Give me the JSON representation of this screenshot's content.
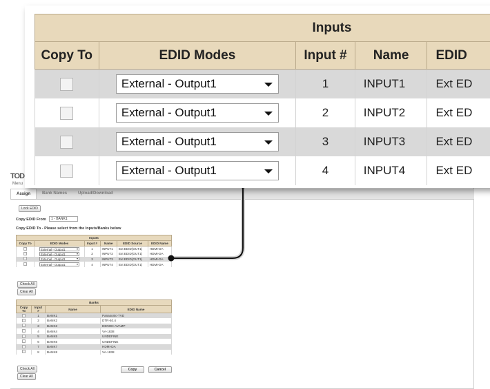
{
  "background": {
    "logo_text": "TOD",
    "menu_label": "Menu",
    "tabs": [
      {
        "label": "Assign",
        "active": true
      },
      {
        "label": "Bank Names",
        "active": false
      },
      {
        "label": "Upload/Download",
        "active": false
      }
    ],
    "lock_edid_button": "Lock EDID",
    "copy_from_label": "Copy EDID From",
    "copy_from_value": "1 - BANK1",
    "copy_to_instruction": "Copy EDID To - Please select from the Inputs/Banks below",
    "inputs_table": {
      "title": "Inputs",
      "headers": [
        "Copy To",
        "EDID Modes",
        "Input #",
        "Name",
        "EDID Source",
        "EDID Name"
      ],
      "rows": [
        {
          "mode": "External - Output1",
          "input": "1",
          "name": "INPUT1",
          "source": "Ext EDID(OUT1)",
          "edid_name": "HDMI-DA"
        },
        {
          "mode": "External - Output1",
          "input": "2",
          "name": "INPUT2",
          "source": "Ext EDID(OUT1)",
          "edid_name": "HDMI-DA"
        },
        {
          "mode": "External - Output1",
          "input": "3",
          "name": "INPUT3",
          "source": "Ext EDID(OUT1)",
          "edid_name": "HDMI-DA"
        },
        {
          "mode": "External - Output1",
          "input": "4",
          "name": "INPUT4",
          "source": "Ext EDID(OUT1)",
          "edid_name": "HDMI-DA"
        }
      ]
    },
    "check_all_button": "Check All",
    "clear_all_button": "Clear All",
    "banks_table": {
      "title": "Banks",
      "headers": [
        "Copy To",
        "Input #",
        "Name",
        "EDID Name"
      ],
      "rows": [
        {
          "input": "1",
          "name": "BANK1",
          "edid_name": "Panasonic-TVD"
        },
        {
          "input": "2",
          "name": "BANK2",
          "edid_name": "DTR-40.4"
        },
        {
          "input": "3",
          "name": "BANK3",
          "edid_name": "DENON-AVAMP"
        },
        {
          "input": "4",
          "name": "BANK4",
          "edid_name": "VA-1838"
        },
        {
          "input": "5",
          "name": "BANK5",
          "edid_name": "UNDEFINE"
        },
        {
          "input": "6",
          "name": "BANK6",
          "edid_name": "UNDEFINE"
        },
        {
          "input": "7",
          "name": "BANK7",
          "edid_name": "HDMI-DA"
        },
        {
          "input": "8",
          "name": "BANK8",
          "edid_name": "VA-1838"
        }
      ]
    },
    "check_all_button_2": "Check All",
    "clear_all_button_2": "Clear All",
    "copy_button": "Copy",
    "cancel_button": "Cancel"
  },
  "zoom": {
    "title": "Inputs",
    "headers": [
      "Copy To",
      "EDID Modes",
      "Input #",
      "Name",
      "EDID"
    ],
    "rows": [
      {
        "mode": "External - Output1",
        "input": "1",
        "name": "INPUT1",
        "source": "Ext ED"
      },
      {
        "mode": "External - Output1",
        "input": "2",
        "name": "INPUT2",
        "source": "Ext ED"
      },
      {
        "mode": "External - Output1",
        "input": "3",
        "name": "INPUT3",
        "source": "Ext ED"
      },
      {
        "mode": "External - Output1",
        "input": "4",
        "name": "INPUT4",
        "source": "Ext ED"
      }
    ]
  },
  "colors": {
    "header_bg": "#e8d9bb",
    "row_alt_bg": "#d9d9d9",
    "callout_line": "#111111"
  }
}
